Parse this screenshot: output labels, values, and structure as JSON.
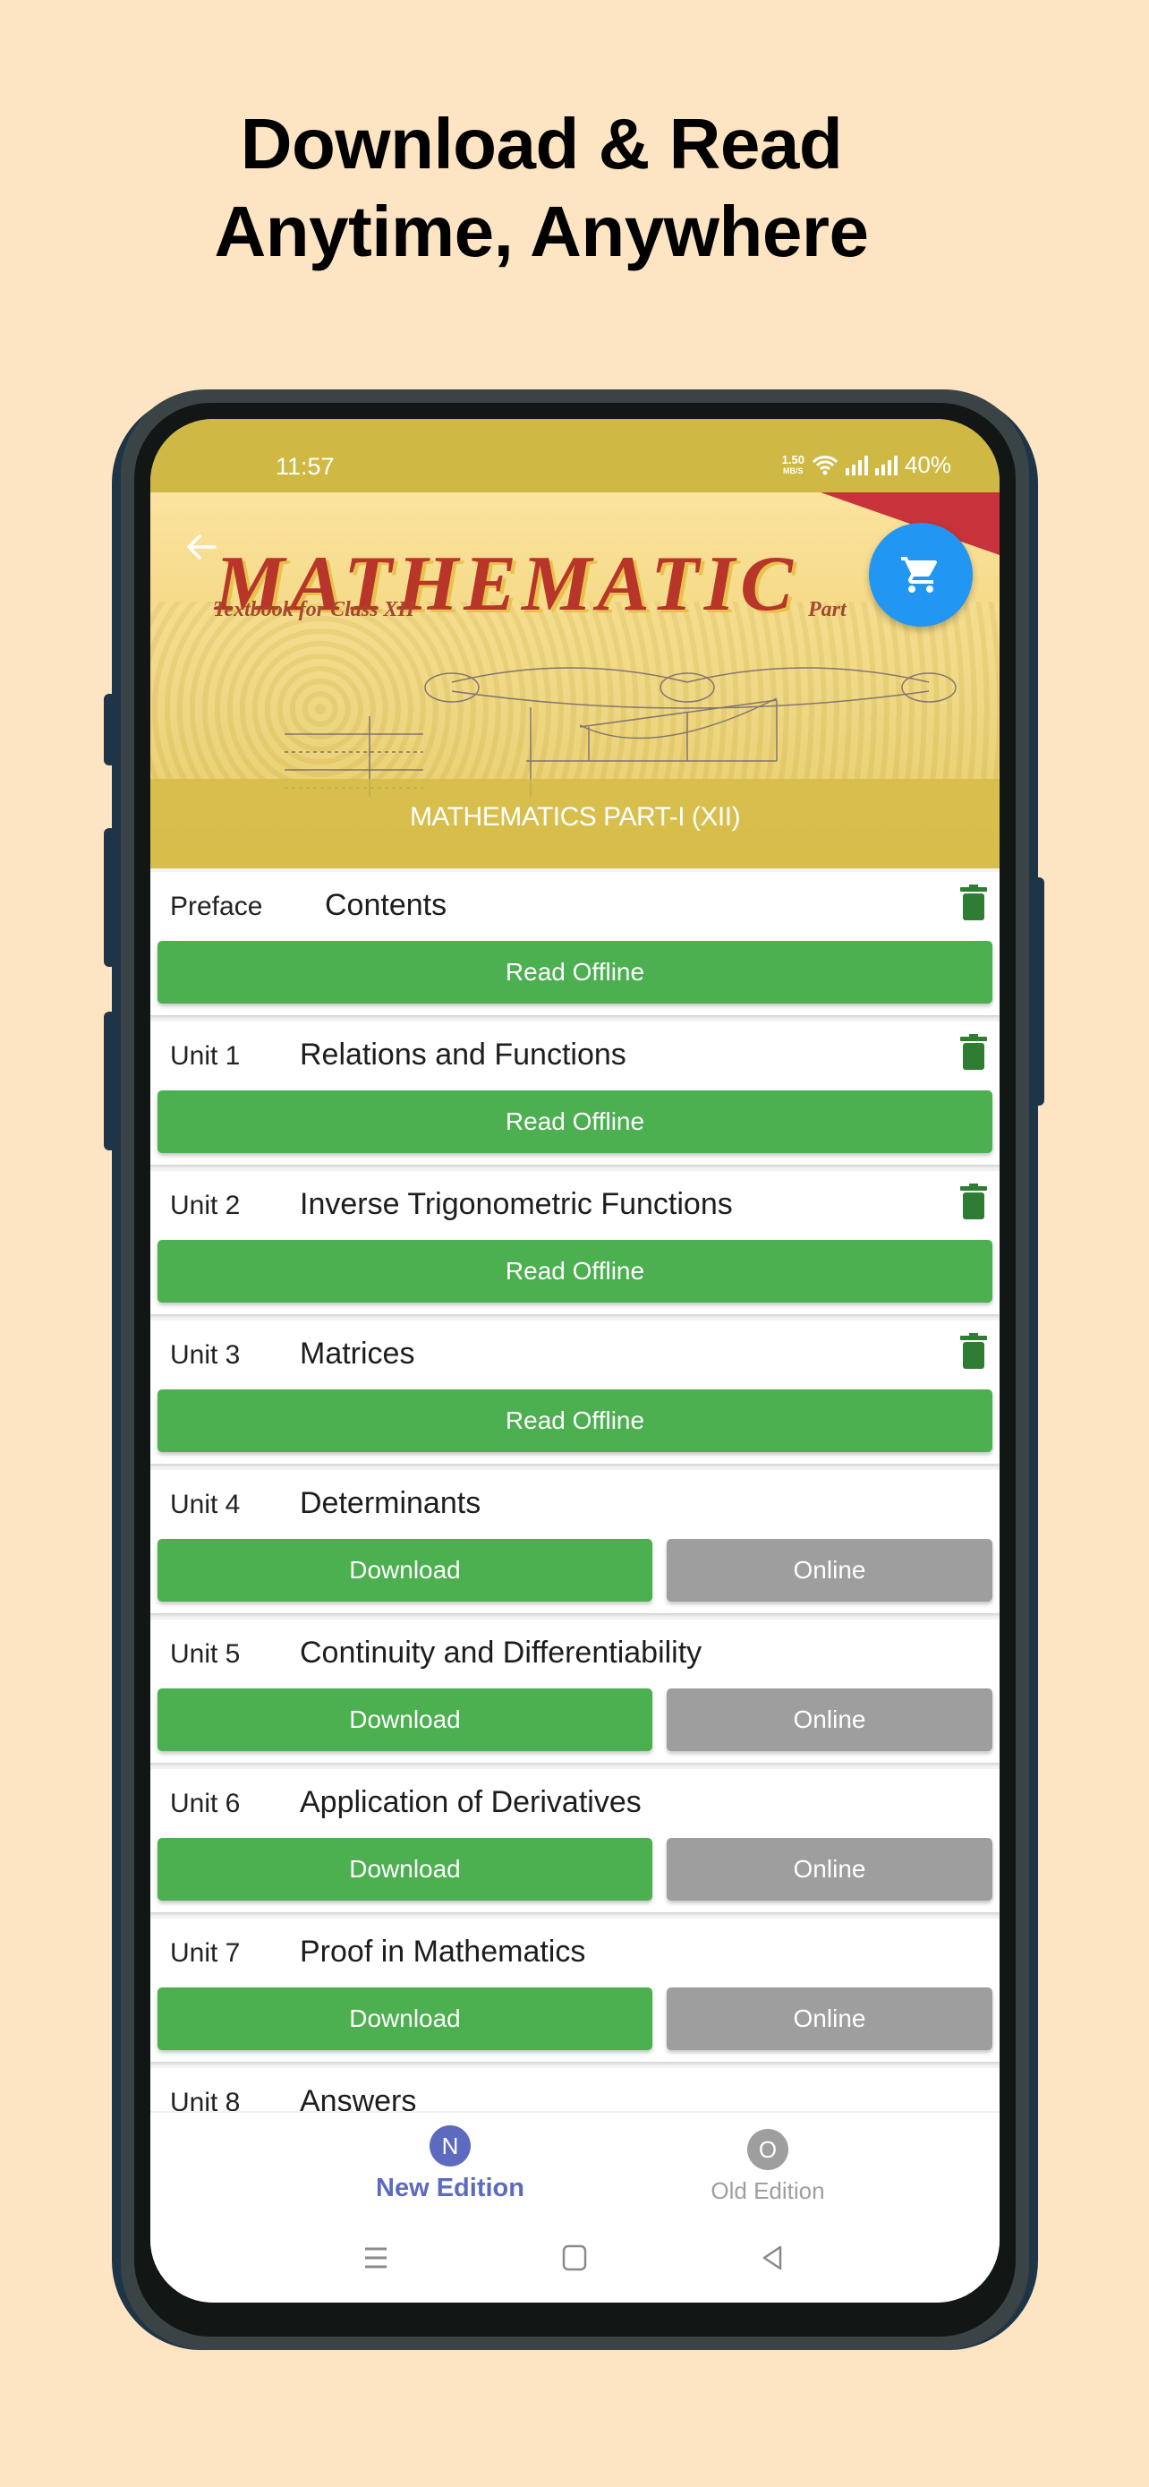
{
  "headline": {
    "line1": "Download & Read",
    "line2": "Anytime, Anywhere"
  },
  "colors": {
    "background": "#FDE4C3",
    "status_bar": "#CFB944",
    "primary_green": "#4CAF50",
    "trash_green": "#2E7D32",
    "online_grey": "#9E9E9E",
    "cart_blue": "#2196F3",
    "active_tab": "#5C6BC0"
  },
  "status_bar": {
    "time": "11:57",
    "net_speed_value": "1.50",
    "net_speed_unit": "MB/S",
    "battery": "40%",
    "icons": [
      "wifi-icon",
      "signal-icon",
      "signal-icon"
    ]
  },
  "banner": {
    "cover_title": "MATHEMATIC",
    "cover_subtitle": "Textbook for Class XII",
    "cover_part": "Part",
    "book_title": "MATHEMATICS PART-I (XII)",
    "back_icon": "arrow-left-icon",
    "cart_icon": "shopping-cart-icon"
  },
  "chapters": [
    {
      "unit": "Preface",
      "title": "Contents",
      "downloaded": true,
      "primary_action": "Read Offline",
      "delete_icon": "trash-icon"
    },
    {
      "unit": "Unit 1",
      "title": "Relations and Functions",
      "downloaded": true,
      "primary_action": "Read Offline",
      "delete_icon": "trash-icon"
    },
    {
      "unit": "Unit 2",
      "title": "Inverse Trigonometric Functions",
      "downloaded": true,
      "primary_action": "Read Offline",
      "delete_icon": "trash-icon"
    },
    {
      "unit": "Unit 3",
      "title": "Matrices",
      "downloaded": true,
      "primary_action": "Read Offline",
      "delete_icon": "trash-icon"
    },
    {
      "unit": "Unit 4",
      "title": "Determinants",
      "downloaded": false,
      "primary_action": "Download",
      "secondary_action": "Online"
    },
    {
      "unit": "Unit 5",
      "title": "Continuity and Differentiability",
      "downloaded": false,
      "primary_action": "Download",
      "secondary_action": "Online"
    },
    {
      "unit": "Unit 6",
      "title": "Application of Derivatives",
      "downloaded": false,
      "primary_action": "Download",
      "secondary_action": "Online"
    },
    {
      "unit": "Unit 7",
      "title": "Proof in Mathematics",
      "downloaded": false,
      "primary_action": "Download",
      "secondary_action": "Online"
    },
    {
      "unit": "Unit 8",
      "title": "Answers"
    }
  ],
  "bottom_nav": {
    "tabs": [
      {
        "badge": "N",
        "label": "New Edition",
        "active": true
      },
      {
        "badge": "O",
        "label": "Old Edition",
        "active": false
      }
    ]
  },
  "system_nav": {
    "buttons": [
      "recents-icon",
      "home-icon",
      "back-triangle-icon"
    ]
  }
}
